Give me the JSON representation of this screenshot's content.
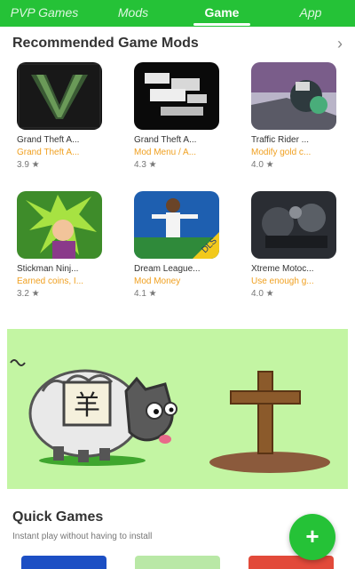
{
  "tabs": [
    {
      "label": "PVP Games"
    },
    {
      "label": "Mods"
    },
    {
      "label": "Game"
    },
    {
      "label": "App"
    }
  ],
  "active_tab": "Game",
  "recommended": {
    "title": "Recommended Game Mods",
    "apps": [
      {
        "name": "Grand Theft A...",
        "sub": "Grand Theft A...",
        "rating": "3.9 ★"
      },
      {
        "name": "Grand Theft A...",
        "sub": "Mod Menu / A...",
        "rating": "4.3 ★"
      },
      {
        "name": "Traffic Rider ...",
        "sub": "Modify gold c...",
        "rating": "4.0 ★"
      },
      {
        "name": "Stickman Ninj...",
        "sub": "Earned coins, I...",
        "rating": "3.2 ★"
      },
      {
        "name": "Dream League...",
        "sub": "Mod Money",
        "rating": "4.1 ★"
      },
      {
        "name": "Xtreme Motoc...",
        "sub": "Use enough g...",
        "rating": "4.0 ★"
      }
    ]
  },
  "quick_games": {
    "title": "Quick Games",
    "subtitle": "Instant play without having to install"
  },
  "fab_label": "+",
  "colors": {
    "accent": "#25c237",
    "banner_bg": "#c3f5a3",
    "sub_text": "#f0a020"
  }
}
